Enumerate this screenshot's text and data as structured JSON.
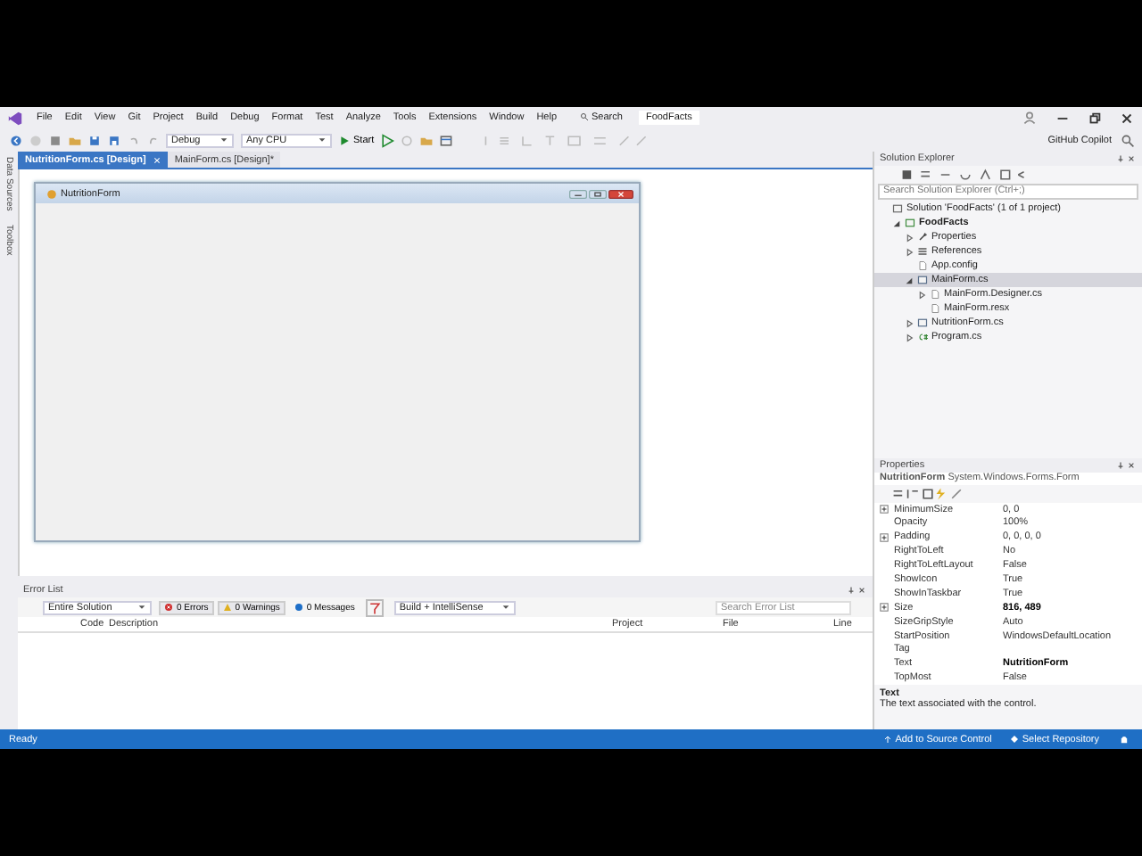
{
  "menu": [
    "File",
    "Edit",
    "View",
    "Git",
    "Project",
    "Build",
    "Debug",
    "Format",
    "Test",
    "Analyze",
    "Tools",
    "Extensions",
    "Window",
    "Help"
  ],
  "search": "Search",
  "solution_name": "FoodFacts",
  "toolbar": {
    "configuration": "Debug",
    "platform": "Any CPU",
    "start": "Start"
  },
  "copilot": "GitHub Copilot",
  "side_tabs": [
    "Data Sources",
    "Toolbox"
  ],
  "doc_tabs": [
    {
      "label": "NutritionForm.cs [Design]",
      "selected": true
    },
    {
      "label": "MainForm.cs [Design]*",
      "selected": false
    }
  ],
  "designer": {
    "form_title": "NutritionForm"
  },
  "solution_explorer": {
    "title": "Solution Explorer",
    "search_placeholder": "Search Solution Explorer (Ctrl+;)",
    "tree": [
      {
        "label": "Solution 'FoodFacts' (1 of 1 project)",
        "kind": "solution",
        "selected": false,
        "children": [
          {
            "label": "FoodFacts",
            "kind": "project",
            "bold": true,
            "expanded": true,
            "selected": false,
            "children": [
              {
                "label": "Properties",
                "kind": "wrench",
                "expanded": false,
                "selected": false
              },
              {
                "label": "References",
                "kind": "references",
                "expanded": false,
                "selected": false
              },
              {
                "label": "App.config",
                "kind": "file",
                "selected": false
              },
              {
                "label": "MainForm.cs",
                "kind": "form",
                "expanded": true,
                "selected": true,
                "children": [
                  {
                    "label": "MainForm.Designer.cs",
                    "kind": "file",
                    "expanded": false,
                    "selected": false
                  },
                  {
                    "label": "MainForm.resx",
                    "kind": "file",
                    "selected": false
                  }
                ]
              },
              {
                "label": "NutritionForm.cs",
                "kind": "form",
                "expanded": false,
                "selected": false
              },
              {
                "label": "Program.cs",
                "kind": "csharp",
                "expanded": false,
                "selected": false
              }
            ]
          }
        ]
      }
    ]
  },
  "properties": {
    "title": "Properties",
    "object_name": "NutritionForm",
    "object_type": "System.Windows.Forms.Form",
    "rows": [
      {
        "name": "MinimumSize",
        "value": "0, 0",
        "expandable": true,
        "modified": false
      },
      {
        "name": "Opacity",
        "value": "100%",
        "expandable": false,
        "modified": false
      },
      {
        "name": "Padding",
        "value": "0, 0, 0, 0",
        "expandable": true,
        "modified": false
      },
      {
        "name": "RightToLeft",
        "value": "No",
        "expandable": false,
        "modified": false
      },
      {
        "name": "RightToLeftLayout",
        "value": "False",
        "expandable": false,
        "modified": false
      },
      {
        "name": "ShowIcon",
        "value": "True",
        "expandable": false,
        "modified": false
      },
      {
        "name": "ShowInTaskbar",
        "value": "True",
        "expandable": false,
        "modified": false
      },
      {
        "name": "Size",
        "value": "816, 489",
        "expandable": true,
        "modified": true
      },
      {
        "name": "SizeGripStyle",
        "value": "Auto",
        "expandable": false,
        "modified": false
      },
      {
        "name": "StartPosition",
        "value": "WindowsDefaultLocation",
        "expandable": false,
        "modified": false
      },
      {
        "name": "Tag",
        "expandable": false
      },
      {
        "name": "Text",
        "value": "NutritionForm",
        "expandable": false,
        "modified": true
      },
      {
        "name": "TopMost",
        "value": "False",
        "expandable": false,
        "modified": false
      }
    ],
    "description_title": "Text",
    "description": "The text associated with the control."
  },
  "error_list": {
    "title": "Error List",
    "scope": "Entire Solution",
    "errors": "0 Errors",
    "warnings": "0 Warnings",
    "messages": "0 Messages",
    "build_filter": "Build + IntelliSense",
    "search_placeholder": "Search Error List",
    "columns": [
      "Code",
      "Description",
      "Project",
      "File",
      "Line"
    ]
  },
  "status": {
    "left": "Ready",
    "source_control": "Add to Source Control",
    "repository": "Select Repository"
  }
}
